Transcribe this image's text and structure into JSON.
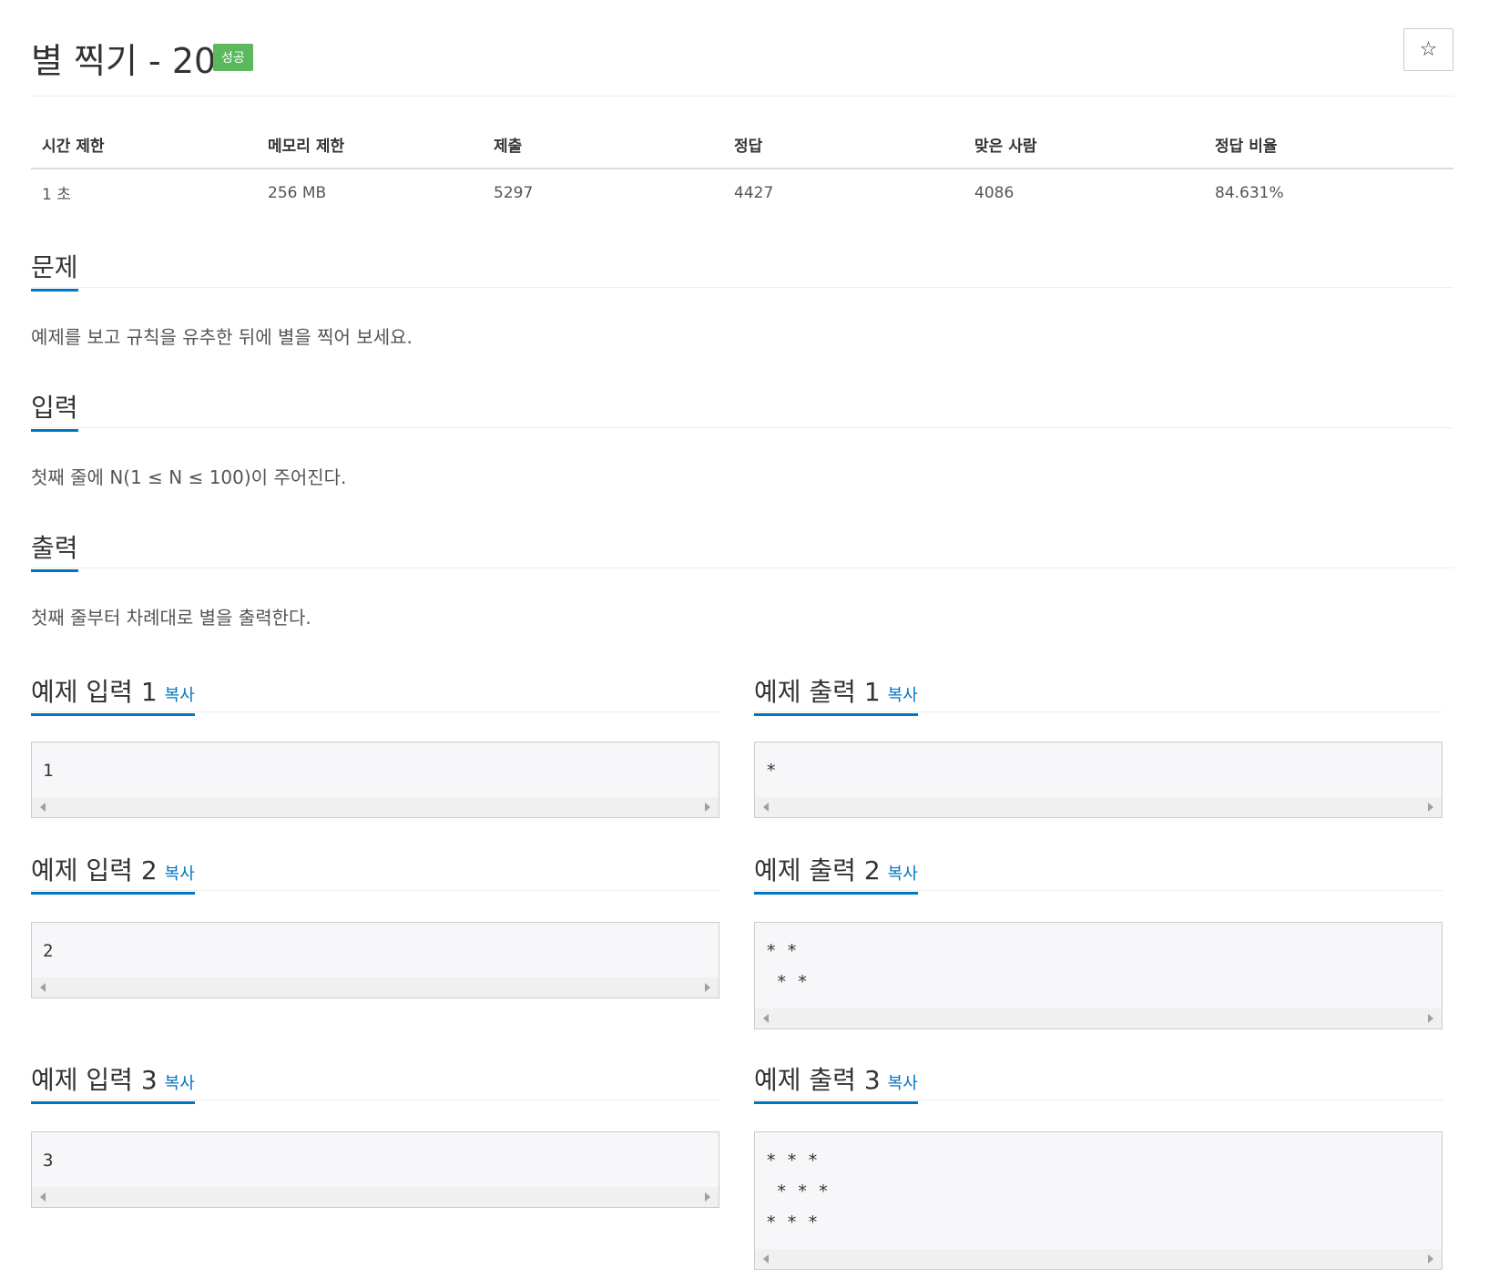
{
  "problem": {
    "title": "별 찍기 - 20",
    "badge": "성공",
    "star_icon": "☆"
  },
  "info": {
    "headers": [
      "시간 제한",
      "메모리 제한",
      "제출",
      "정답",
      "맞은 사람",
      "정답 비율"
    ],
    "values": [
      "1 초",
      "256 MB",
      "5297",
      "4427",
      "4086",
      "84.631%"
    ]
  },
  "sections": {
    "problem_title": "문제",
    "problem_text": "예제를 보고 규칙을 유추한 뒤에 별을 찍어 보세요.",
    "input_title": "입력",
    "input_text": "첫째 줄에 N(1 ≤ N ≤ 100)이 주어진다.",
    "output_title": "출력",
    "output_text": "첫째 줄부터 차례대로 별을 출력한다."
  },
  "copy_label": "복사",
  "samples": [
    {
      "input_title": "예제 입력 1",
      "input": "1",
      "output_title": "예제 출력 1",
      "output": "*"
    },
    {
      "input_title": "예제 입력 2",
      "input": "2",
      "output_title": "예제 출력 2",
      "output": "* *\n * *"
    },
    {
      "input_title": "예제 입력 3",
      "input": "3",
      "output_title": "예제 출력 3",
      "output": "* * *\n * * *\n* * *"
    }
  ],
  "colors": {
    "accent": "#0076c0",
    "success": "#5cb85c"
  }
}
